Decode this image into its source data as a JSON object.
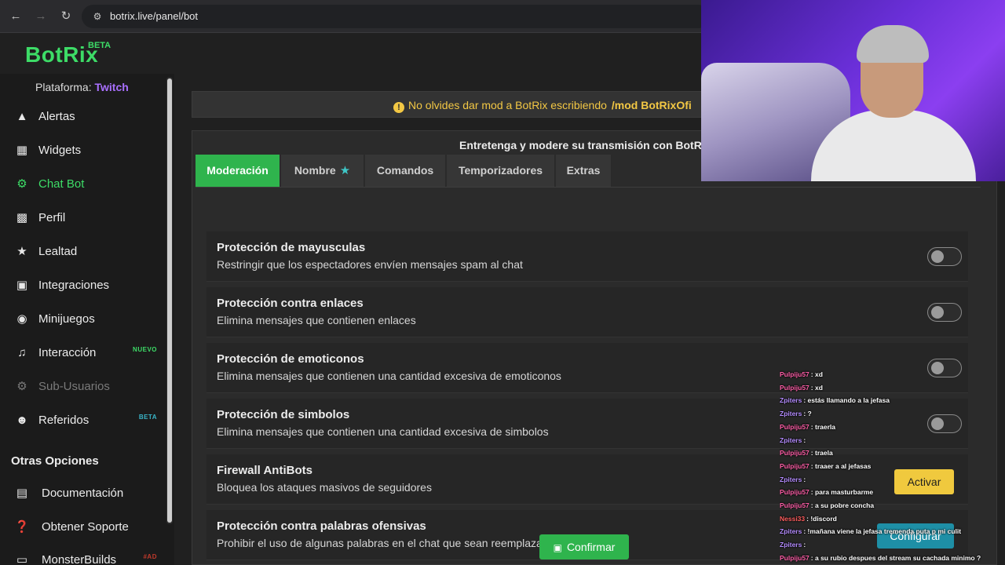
{
  "browser": {
    "url": "botrix.live/panel/bot"
  },
  "logo": {
    "name": "BotRix",
    "badge": "BETA"
  },
  "sidebar": {
    "platform_label": "Plataforma:",
    "platform_value": "Twitch",
    "items": [
      {
        "label": "Alertas",
        "icon": "warning-icon",
        "badge": ""
      },
      {
        "label": "Widgets",
        "icon": "grid-icon",
        "badge": ""
      },
      {
        "label": "Chat Bot",
        "icon": "robot-icon",
        "badge": ""
      },
      {
        "label": "Perfil",
        "icon": "id-card-icon",
        "badge": ""
      },
      {
        "label": "Lealtad",
        "icon": "trophy-icon",
        "badge": ""
      },
      {
        "label": "Integraciones",
        "icon": "discord-icon",
        "badge": ""
      },
      {
        "label": "Minijuegos",
        "icon": "gamepad-icon",
        "badge": ""
      },
      {
        "label": "Interacción",
        "icon": "music-icon",
        "badge": "NUEVO"
      },
      {
        "label": "Sub-Usuarios",
        "icon": "cog-icon",
        "badge": ""
      },
      {
        "label": "Referidos",
        "icon": "users-icon",
        "badge": "BETA"
      }
    ],
    "section_title": "Otras Opciones",
    "options": [
      {
        "label": "Documentación",
        "icon": "book-icon",
        "badge": ""
      },
      {
        "label": "Obtener Soporte",
        "icon": "question-icon",
        "badge": ""
      },
      {
        "label": "MonsterBuilds",
        "icon": "monitor-icon",
        "badge": "#AD"
      }
    ]
  },
  "notice": {
    "text": "No olvides dar mod a BotRix escribiendo",
    "command": "/mod BotRixOfi"
  },
  "main": {
    "title": "Entretenga y modere su transmisión con BotR",
    "tabs": [
      {
        "label": "Moderación"
      },
      {
        "label": "Nombre"
      },
      {
        "label": "Comandos"
      },
      {
        "label": "Temporizadores"
      },
      {
        "label": "Extras"
      }
    ],
    "active_tab": "Moderación",
    "rows": [
      {
        "title": "Protección de mayusculas",
        "desc": "Restringir que los espectadores envíen mensajes spam al chat",
        "control": "toggle",
        "enabled": false
      },
      {
        "title": "Protección contra enlaces",
        "desc": "Elimina mensajes que contienen enlaces",
        "control": "toggle",
        "enabled": false
      },
      {
        "title": "Protección de emoticonos",
        "desc": "Elimina mensajes que contienen una cantidad excesiva de emoticonos",
        "control": "toggle",
        "enabled": false
      },
      {
        "title": "Protección de simbolos",
        "desc": "Elimina mensajes que contienen una cantidad excesiva de simbolos",
        "control": "toggle",
        "enabled": false
      },
      {
        "title": "Firewall AntiBots",
        "desc": "Bloquea los ataques masivos de seguidores",
        "control": "button",
        "button_label": "Activar"
      },
      {
        "title": "Protección contra palabras ofensivas",
        "desc": "Prohibir el uso de algunas palabras en el chat que sean reemplazadas por \"*\"",
        "control": "button",
        "button_label": "Configurar"
      }
    ],
    "confirm_label": "Confirmar"
  },
  "chat_overlay": [
    {
      "user": "Pulpiju57",
      "msg": ": xd",
      "color": "#ff5fa8"
    },
    {
      "user": "Pulpiju57",
      "msg": ": xd",
      "color": "#ff5fa8"
    },
    {
      "user": "Zpiters",
      "msg": ": estás llamando a la jefasa",
      "color": "#b48cff"
    },
    {
      "user": "Zpiters",
      "msg": ": ?",
      "color": "#b48cff"
    },
    {
      "user": "Pulpiju57",
      "msg": ": traerla",
      "color": "#ff5fa8"
    },
    {
      "user": "Zpiters",
      "msg": ":",
      "color": "#b48cff"
    },
    {
      "user": "Pulpiju57",
      "msg": ": traela",
      "color": "#ff5fa8"
    },
    {
      "user": "Pulpiju57",
      "msg": ": traaer a al jefasas",
      "color": "#ff5fa8"
    },
    {
      "user": "Zpiters",
      "msg": ":",
      "color": "#b48cff"
    },
    {
      "user": "Pulpiju57",
      "msg": ": para masturbarme",
      "color": "#ff5fa8"
    },
    {
      "user": "Pulpiju57",
      "msg": ": a su pobre concha",
      "color": "#ff5fa8"
    },
    {
      "user": "Nessi33",
      "msg": ": !discord",
      "color": "#ff5f5f"
    },
    {
      "user": "Zpiters",
      "msg": ": !mañana viene la jefasa tremenda puta p mi culit",
      "color": "#b48cff"
    },
    {
      "user": "Zpiters",
      "msg": ":",
      "color": "#b48cff"
    },
    {
      "user": "Pulpiju57",
      "msg": ": a su rubio despues del stream su cachada minimo ?",
      "color": "#ff5fa8"
    }
  ],
  "colors": {
    "accent_green": "#2fb44d",
    "logo_green": "#3ddc67",
    "twitch_purple": "#a970ff",
    "notice_yellow": "#f2c744",
    "button_yellow": "#f0c93e",
    "button_teal": "#1e8fa6"
  }
}
